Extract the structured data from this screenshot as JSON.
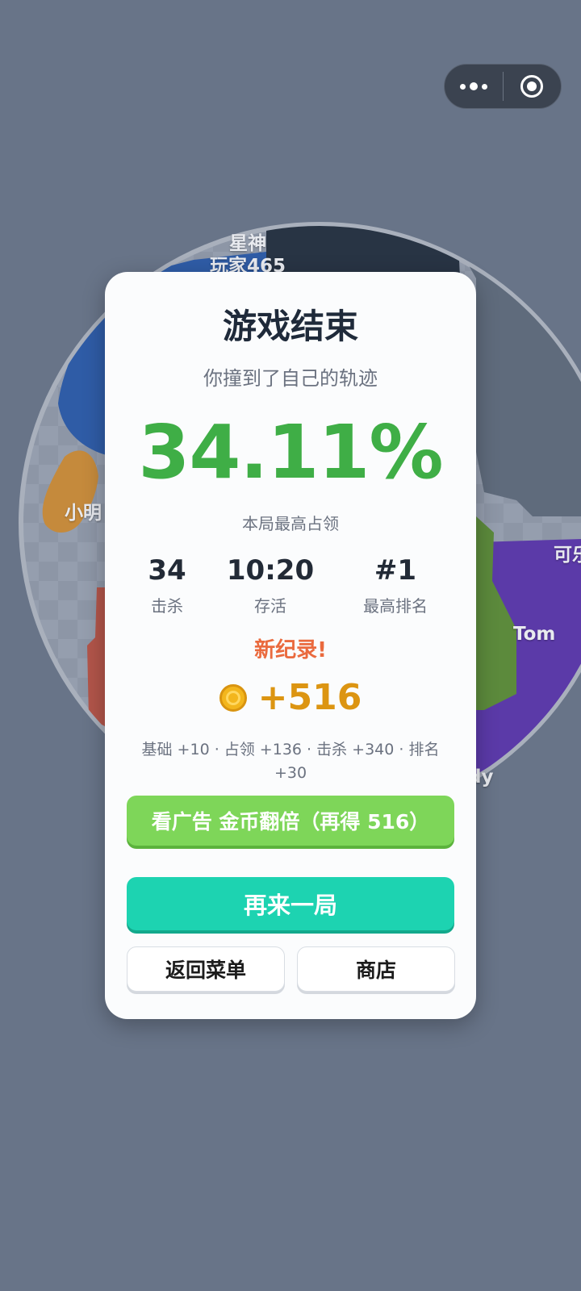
{
  "colors": {
    "background": "#687488",
    "percent_green": "#3fae46",
    "record_orange": "#ea6a3e",
    "coin_gold": "#dc9512",
    "ad_button": "#7ed659",
    "again_button": "#1dd3b1"
  },
  "top_capsule": {
    "icons": [
      "more-dots-icon",
      "close-target-icon"
    ]
  },
  "map": {
    "labels": [
      "星神",
      "玩家465",
      "小明",
      "可乐",
      "Tom",
      "dy"
    ]
  },
  "result": {
    "title": "游戏结束",
    "reason": "你撞到了自己的轨迹",
    "percent": "34.11%",
    "percent_label": "本局最高占领",
    "stats": [
      {
        "value": "34",
        "label": "击杀"
      },
      {
        "value": "10:20",
        "label": "存活"
      },
      {
        "value": "#1",
        "label": "最高排名"
      }
    ],
    "record_text": "新纪录!",
    "coins": "+516",
    "breakdown": "基础 +10 · 占领 +136 · 击杀 +340 · 排名 +30"
  },
  "buttons": {
    "ad_double": "看广告 金币翻倍（再得 516）",
    "play_again": "再来一局",
    "back_menu": "返回菜单",
    "shop": "商店"
  }
}
